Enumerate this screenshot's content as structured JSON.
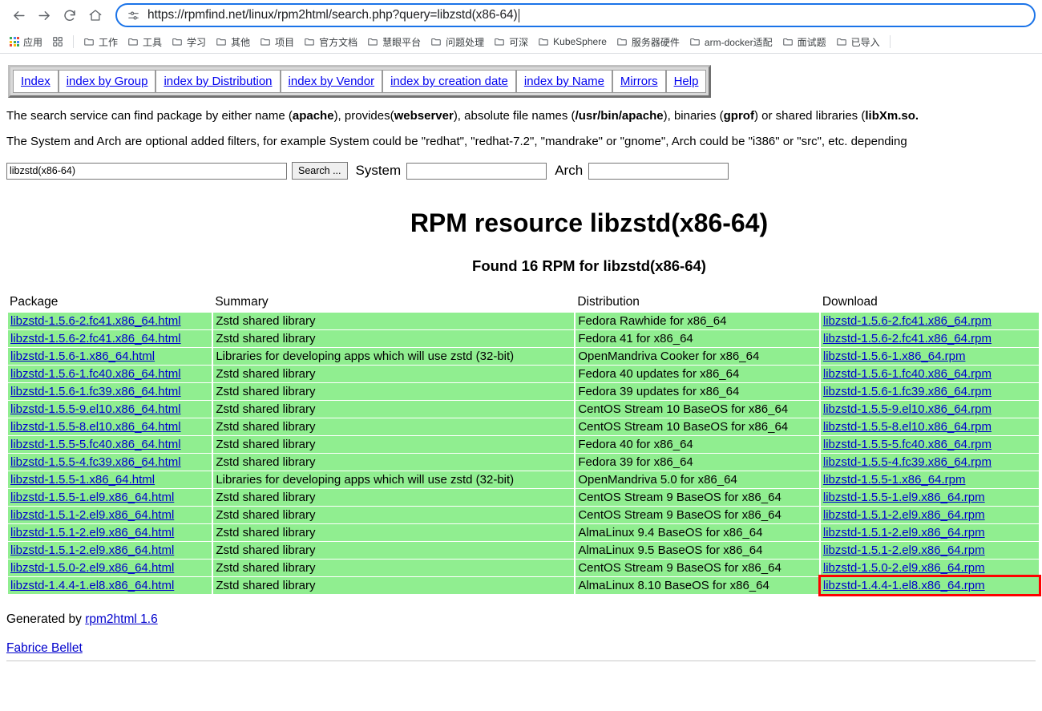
{
  "browser": {
    "back_icon": "back-arrow-icon",
    "forward_icon": "forward-arrow-icon",
    "reload_icon": "reload-icon",
    "home_icon": "home-icon",
    "url": "https://rpmfind.net/linux/rpm2html/search.php?query=libzstd(x86-64)",
    "site_info_icon": "site-settings-icon",
    "bookmarks": [
      {
        "label": "应用",
        "icon": "apps-grid-icon"
      },
      {
        "label": "",
        "icon": "reading-list-icon"
      },
      {
        "label": "工作",
        "icon": "folder-icon"
      },
      {
        "label": "工具",
        "icon": "folder-icon"
      },
      {
        "label": "学习",
        "icon": "folder-icon"
      },
      {
        "label": "其他",
        "icon": "folder-icon"
      },
      {
        "label": "项目",
        "icon": "folder-icon"
      },
      {
        "label": "官方文档",
        "icon": "folder-icon"
      },
      {
        "label": "慧眼平台",
        "icon": "folder-icon"
      },
      {
        "label": "问题处理",
        "icon": "folder-icon"
      },
      {
        "label": "可深",
        "icon": "folder-icon"
      },
      {
        "label": "KubeSphere",
        "icon": "folder-icon"
      },
      {
        "label": "服务器硬件",
        "icon": "folder-icon"
      },
      {
        "label": "arm-docker适配",
        "icon": "folder-icon"
      },
      {
        "label": "面试题",
        "icon": "folder-icon"
      },
      {
        "label": "已导入",
        "icon": "folder-icon"
      }
    ]
  },
  "nav_links": [
    "Index",
    "index by Group",
    "index by Distribution",
    "index by Vendor",
    "index by creation date",
    "index by Name",
    "Mirrors",
    "Help"
  ],
  "description": {
    "line1_parts": [
      {
        "t": "The search service can find package by either name (",
        "b": false
      },
      {
        "t": "apache",
        "b": true
      },
      {
        "t": "), provides(",
        "b": false
      },
      {
        "t": "webserver",
        "b": true
      },
      {
        "t": "), absolute file names (",
        "b": false
      },
      {
        "t": "/usr/bin/apache",
        "b": true
      },
      {
        "t": "), binaries (",
        "b": false
      },
      {
        "t": "gprof",
        "b": true
      },
      {
        "t": ") or shared libraries (",
        "b": false
      },
      {
        "t": "libXm.so.",
        "b": true
      }
    ],
    "line2": "The System and Arch are optional added filters, for example System could be \"redhat\", \"redhat-7.2\", \"mandrake\" or \"gnome\", Arch could be \"i386\" or \"src\", etc. depending"
  },
  "search_form": {
    "query_value": "libzstd(x86-64)",
    "query_placeholder": "",
    "search_button": "Search ...",
    "system_label": "System",
    "system_value": "",
    "arch_label": "Arch",
    "arch_value": ""
  },
  "results": {
    "title": "RPM resource libzstd(x86-64)",
    "found_line": "Found 16 RPM for libzstd(x86-64)",
    "columns": [
      "Package",
      "Summary",
      "Distribution",
      "Download"
    ],
    "rows": [
      {
        "package": "libzstd-1.5.6-2.fc41.x86_64.html",
        "summary": "Zstd shared library",
        "distribution": "Fedora Rawhide for x86_64",
        "download": "libzstd-1.5.6-2.fc41.x86_64.rpm",
        "highlighted": false
      },
      {
        "package": "libzstd-1.5.6-2.fc41.x86_64.html",
        "summary": "Zstd shared library",
        "distribution": "Fedora 41 for x86_64",
        "download": "libzstd-1.5.6-2.fc41.x86_64.rpm",
        "highlighted": false
      },
      {
        "package": "libzstd-1.5.6-1.x86_64.html",
        "summary": "Libraries for developing apps which will use zstd (32-bit)",
        "distribution": "OpenMandriva Cooker for x86_64",
        "download": "libzstd-1.5.6-1.x86_64.rpm",
        "highlighted": false
      },
      {
        "package": "libzstd-1.5.6-1.fc40.x86_64.html",
        "summary": "Zstd shared library",
        "distribution": "Fedora 40 updates for x86_64",
        "download": "libzstd-1.5.6-1.fc40.x86_64.rpm",
        "highlighted": false
      },
      {
        "package": "libzstd-1.5.6-1.fc39.x86_64.html",
        "summary": "Zstd shared library",
        "distribution": "Fedora 39 updates for x86_64",
        "download": "libzstd-1.5.6-1.fc39.x86_64.rpm",
        "highlighted": false
      },
      {
        "package": "libzstd-1.5.5-9.el10.x86_64.html",
        "summary": "Zstd shared library",
        "distribution": "CentOS Stream 10 BaseOS for x86_64",
        "download": "libzstd-1.5.5-9.el10.x86_64.rpm",
        "highlighted": false
      },
      {
        "package": "libzstd-1.5.5-8.el10.x86_64.html",
        "summary": "Zstd shared library",
        "distribution": "CentOS Stream 10 BaseOS for x86_64",
        "download": "libzstd-1.5.5-8.el10.x86_64.rpm",
        "highlighted": false
      },
      {
        "package": "libzstd-1.5.5-5.fc40.x86_64.html",
        "summary": "Zstd shared library",
        "distribution": "Fedora 40 for x86_64",
        "download": "libzstd-1.5.5-5.fc40.x86_64.rpm",
        "highlighted": false
      },
      {
        "package": "libzstd-1.5.5-4.fc39.x86_64.html",
        "summary": "Zstd shared library",
        "distribution": "Fedora 39 for x86_64",
        "download": "libzstd-1.5.5-4.fc39.x86_64.rpm",
        "highlighted": false
      },
      {
        "package": "libzstd-1.5.5-1.x86_64.html",
        "summary": "Libraries for developing apps which will use zstd (32-bit)",
        "distribution": "OpenMandriva 5.0 for x86_64",
        "download": "libzstd-1.5.5-1.x86_64.rpm",
        "highlighted": false
      },
      {
        "package": "libzstd-1.5.5-1.el9.x86_64.html",
        "summary": "Zstd shared library",
        "distribution": "CentOS Stream 9 BaseOS for x86_64",
        "download": "libzstd-1.5.5-1.el9.x86_64.rpm",
        "highlighted": false
      },
      {
        "package": "libzstd-1.5.1-2.el9.x86_64.html",
        "summary": "Zstd shared library",
        "distribution": "CentOS Stream 9 BaseOS for x86_64",
        "download": "libzstd-1.5.1-2.el9.x86_64.rpm",
        "highlighted": false
      },
      {
        "package": "libzstd-1.5.1-2.el9.x86_64.html",
        "summary": "Zstd shared library",
        "distribution": "AlmaLinux 9.4 BaseOS for x86_64",
        "download": "libzstd-1.5.1-2.el9.x86_64.rpm",
        "highlighted": false
      },
      {
        "package": "libzstd-1.5.1-2.el9.x86_64.html",
        "summary": "Zstd shared library",
        "distribution": "AlmaLinux 9.5 BaseOS for x86_64",
        "download": "libzstd-1.5.1-2.el9.x86_64.rpm",
        "highlighted": false
      },
      {
        "package": "libzstd-1.5.0-2.el9.x86_64.html",
        "summary": "Zstd shared library",
        "distribution": "CentOS Stream 9 BaseOS for x86_64",
        "download": "libzstd-1.5.0-2.el9.x86_64.rpm",
        "highlighted": false
      },
      {
        "package": "libzstd-1.4.4-1.el8.x86_64.html",
        "summary": "Zstd shared library",
        "distribution": "AlmaLinux 8.10 BaseOS for x86_64",
        "download": "libzstd-1.4.4-1.el8.x86_64.rpm",
        "highlighted": true
      }
    ]
  },
  "footer": {
    "generated_prefix": "Generated by ",
    "generator_link": "rpm2html 1.6",
    "author_link": "Fabrice Bellet"
  },
  "colors": {
    "row_green": "#90ee90",
    "link_blue": "#0000cc",
    "highlight_red": "#ff0000",
    "omnibox_focus": "#1a73e8"
  }
}
